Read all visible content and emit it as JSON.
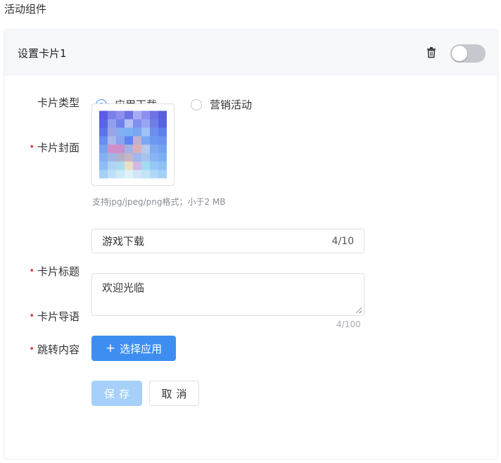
{
  "section_title": "活动组件",
  "card": {
    "title": "设置卡片1",
    "toggle_on": false
  },
  "form": {
    "card_type": {
      "label": "卡片类型",
      "options": [
        {
          "label": "应用下载",
          "checked": true
        },
        {
          "label": "营销活动",
          "checked": false
        }
      ]
    },
    "cover": {
      "label": "卡片封面",
      "required": true,
      "hint": "支持jpg/jpeg/png格式；小于2 MB"
    },
    "title_field": {
      "label": "卡片标题",
      "required": true,
      "value": "游戏下载",
      "count": "4/10"
    },
    "guide_field": {
      "label": "卡片导语",
      "required": true,
      "value": "欢迎光临",
      "count": "4/100"
    },
    "jump": {
      "label": "跳转内容",
      "required": true,
      "button_label": "选择应用"
    }
  },
  "actions": {
    "save_label": "保存",
    "cancel_label": "取消"
  },
  "colors": {
    "primary": "#3d8ef0",
    "primary_disabled": "#a6d0fa",
    "required": "#e43d33"
  }
}
